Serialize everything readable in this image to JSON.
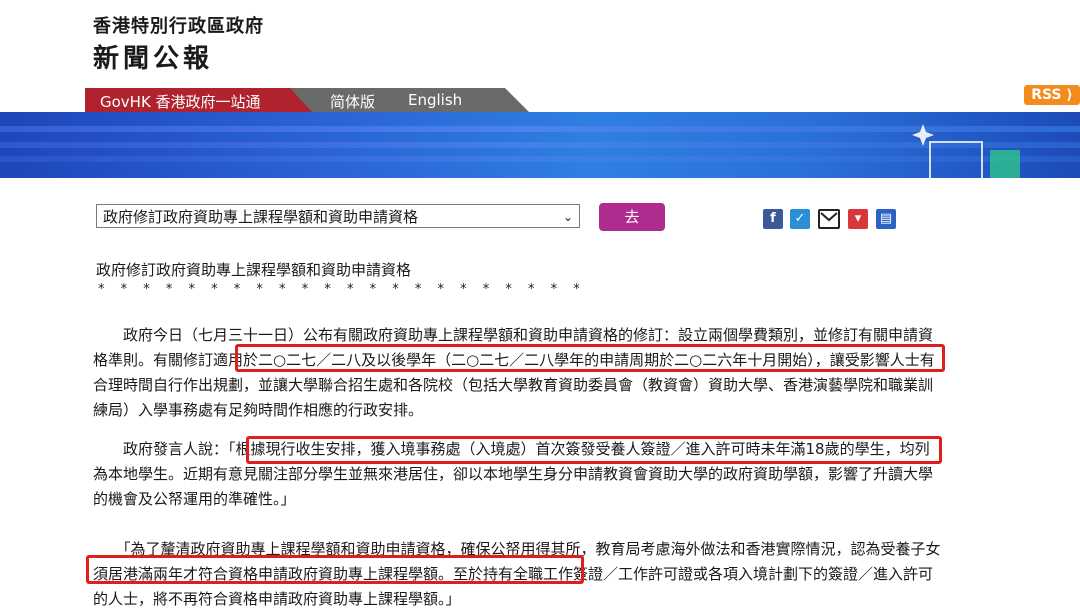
{
  "header": {
    "gov_title": "香港特別行政區政府",
    "news_title": "新聞公報"
  },
  "nav": {
    "govhk": "GovHK 香港政府一站通",
    "simplified": "简体版",
    "english": "English",
    "rss": "RSS"
  },
  "toolbar": {
    "selected_option": "政府修訂政府資助專上課程學額和資助申請資格",
    "go_label": "去"
  },
  "share_icons": [
    "facebook-icon",
    "twitter-icon",
    "email-icon",
    "bookmark-icon",
    "print-icon"
  ],
  "colors": {
    "nav_red": "#b0232e",
    "go_button": "#b02b8e",
    "highlight": "#e01e1e",
    "rss": "#f28c1e"
  },
  "article": {
    "title": "政府修訂政府資助專上課程學額和資助申請資格",
    "stars": "* * * * * * * * * * * * * * * * * * * * * *",
    "para1": "　　政府今日（七月三十一日）公布有關政府資助專上課程學額和資助申請資格的修訂：設立兩個學費類別，並修訂有關申請資格準則。有關修訂適用於二○二七／二八及以後學年（二○二七／二八學年的申請周期於二○二六年十月開始），讓受影響人士有合理時間自行作出規劃，並讓大學聯合招生處和各院校（包括大學教育資助委員會（教資會）資助大學、香港演藝學院和職業訓練局）入學事務處有足夠時間作相應的行政安排。",
    "para2": "　　政府發言人說：「根據現行收生安排，獲入境事務處（入境處）首次簽發受養人簽證／進入許可時未年滿18歲的學生，均列為本地學生。近期有意見關注部分學生並無來港居住，卻以本地學生身分申請教資會資助大學的政府資助學額，影響了升讀大學的機會及公帑運用的準確性。」",
    "para3": "　　「為了釐清政府資助專上課程學額和資助申請資格，確保公帑用得其所，教育局考慮海外做法和香港實際情況，認為受養子女須居港滿兩年才符合資格申請政府資助專上課程學額。至於持有全職工作簽證／工作許可證或各項入境計劃下的簽證／進入許可的人士，將不再符合資格申請政府資助專上課程學額。」"
  }
}
